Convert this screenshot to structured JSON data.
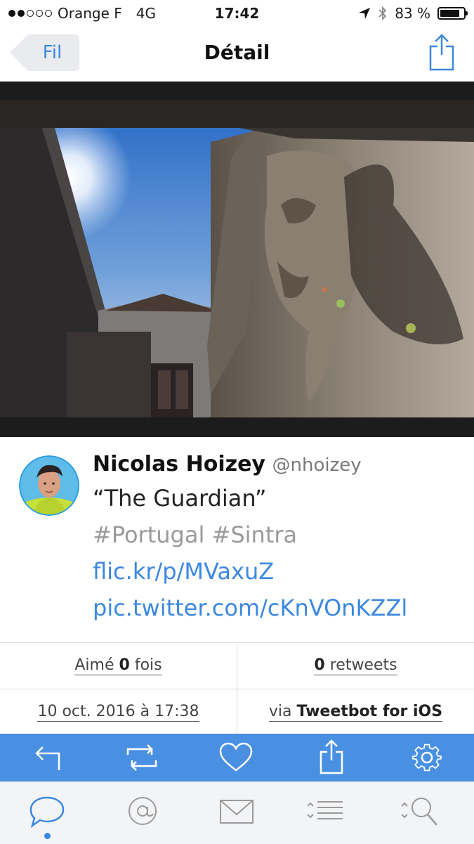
{
  "status_bar": {
    "carrier": "Orange F",
    "network": "4G",
    "time": "17:42",
    "battery_text": "83 %",
    "battery_level": 0.83,
    "signal_bars_filled": 2,
    "signal_bars_total": 5
  },
  "nav": {
    "back_label": "Fil",
    "title": "Détail",
    "share_icon": "share-icon"
  },
  "photo": {
    "page_index": 1,
    "page_count": 1
  },
  "tweet": {
    "author_name": "Nicolas Hoizey",
    "author_handle": "@nhoizey",
    "quote": "“The Guardian”",
    "hashtags": "#Portugal #Sintra",
    "link1": "flic.kr/p/MVaxuZ",
    "link2": "pic.twitter.com/cKnVOnKZZl"
  },
  "stats": {
    "likes_prefix": "Aimé",
    "likes_count": "0",
    "likes_suffix": "fois",
    "retweets_count": "0",
    "retweets_label": "retweets",
    "date": "10 oct. 2016 à 17:38",
    "via_prefix": "via",
    "client": "Tweetbot for iOS"
  },
  "actions": [
    "reply-icon",
    "retweet-icon",
    "heart-icon",
    "share-icon",
    "gear-icon"
  ],
  "tabs": [
    "speech-bubble-icon",
    "at-icon",
    "envelope-icon",
    "list-icon",
    "search-icon"
  ],
  "colors": {
    "accent": "#3b88e0",
    "action_bar": "#4a90e2",
    "tab_bar": "#f3f4f6"
  }
}
